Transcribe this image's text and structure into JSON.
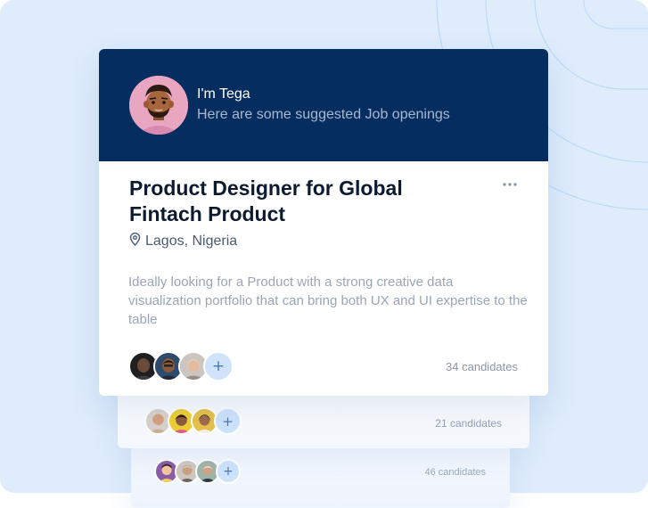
{
  "profile": {
    "greeting": "I'm Tega",
    "subtitle": "Here are some suggested Job openings"
  },
  "job": {
    "title": "Product Designer for Global Fintach Product",
    "location": "Lagos, Nigeria",
    "description": "Ideally looking for a Product  with a strong creative data visualization portfolio that can bring both UX and UI expertise to the table",
    "add_label": "+",
    "candidates": "34 candidates"
  },
  "stacked_cards": [
    {
      "add_label": "+",
      "candidates": "21 candidates"
    },
    {
      "add_label": "+",
      "candidates": "46 candidates"
    }
  ],
  "icons": [
    "more-icon",
    "location-pin-icon",
    "plus-icon"
  ],
  "colors": {
    "background": "#deecfc",
    "header": "#052d5f",
    "title": "#0d1b30",
    "accent_chip": "#cfe3fb"
  }
}
